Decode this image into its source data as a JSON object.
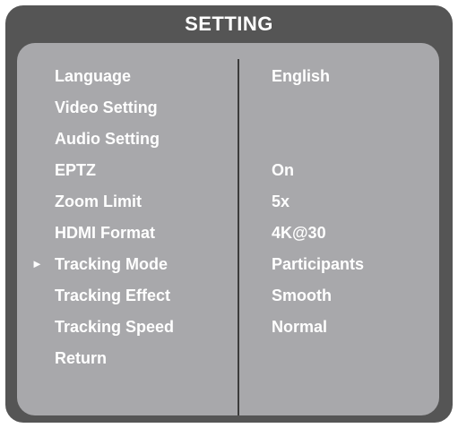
{
  "title": "SETTING",
  "cursor_glyph": "►",
  "menu": {
    "items": [
      {
        "label": "Language",
        "value": "English"
      },
      {
        "label": "Video Setting",
        "value": ""
      },
      {
        "label": "Audio Setting",
        "value": ""
      },
      {
        "label": "EPTZ",
        "value": "On"
      },
      {
        "label": "Zoom Limit",
        "value": "5x"
      },
      {
        "label": "HDMI Format",
        "value": "4K@30"
      },
      {
        "label": "Tracking Mode",
        "value": "Participants"
      },
      {
        "label": "Tracking Effect",
        "value": "Smooth"
      },
      {
        "label": "Tracking Speed",
        "value": "Normal"
      },
      {
        "label": "Return",
        "value": ""
      }
    ],
    "selected_index": 6
  },
  "colors": {
    "frame": "#555555",
    "panel": "#a8a8ab",
    "text": "#ffffff"
  }
}
